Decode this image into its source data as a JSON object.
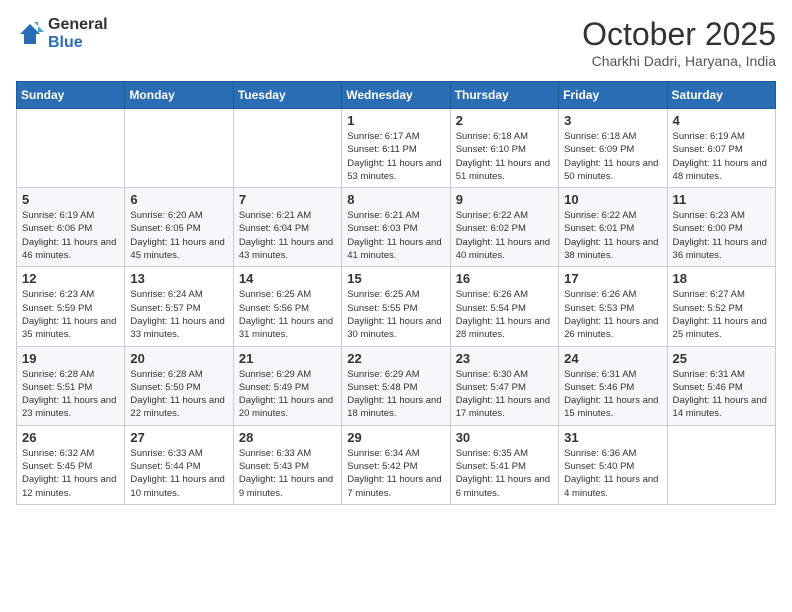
{
  "logo": {
    "general": "General",
    "blue": "Blue"
  },
  "header": {
    "month": "October 2025",
    "location": "Charkhi Dadri, Haryana, India"
  },
  "weekdays": [
    "Sunday",
    "Monday",
    "Tuesday",
    "Wednesday",
    "Thursday",
    "Friday",
    "Saturday"
  ],
  "weeks": [
    [
      {
        "day": "",
        "info": ""
      },
      {
        "day": "",
        "info": ""
      },
      {
        "day": "",
        "info": ""
      },
      {
        "day": "1",
        "info": "Sunrise: 6:17 AM\nSunset: 6:11 PM\nDaylight: 11 hours and 53 minutes."
      },
      {
        "day": "2",
        "info": "Sunrise: 6:18 AM\nSunset: 6:10 PM\nDaylight: 11 hours and 51 minutes."
      },
      {
        "day": "3",
        "info": "Sunrise: 6:18 AM\nSunset: 6:09 PM\nDaylight: 11 hours and 50 minutes."
      },
      {
        "day": "4",
        "info": "Sunrise: 6:19 AM\nSunset: 6:07 PM\nDaylight: 11 hours and 48 minutes."
      }
    ],
    [
      {
        "day": "5",
        "info": "Sunrise: 6:19 AM\nSunset: 6:06 PM\nDaylight: 11 hours and 46 minutes."
      },
      {
        "day": "6",
        "info": "Sunrise: 6:20 AM\nSunset: 6:05 PM\nDaylight: 11 hours and 45 minutes."
      },
      {
        "day": "7",
        "info": "Sunrise: 6:21 AM\nSunset: 6:04 PM\nDaylight: 11 hours and 43 minutes."
      },
      {
        "day": "8",
        "info": "Sunrise: 6:21 AM\nSunset: 6:03 PM\nDaylight: 11 hours and 41 minutes."
      },
      {
        "day": "9",
        "info": "Sunrise: 6:22 AM\nSunset: 6:02 PM\nDaylight: 11 hours and 40 minutes."
      },
      {
        "day": "10",
        "info": "Sunrise: 6:22 AM\nSunset: 6:01 PM\nDaylight: 11 hours and 38 minutes."
      },
      {
        "day": "11",
        "info": "Sunrise: 6:23 AM\nSunset: 6:00 PM\nDaylight: 11 hours and 36 minutes."
      }
    ],
    [
      {
        "day": "12",
        "info": "Sunrise: 6:23 AM\nSunset: 5:59 PM\nDaylight: 11 hours and 35 minutes."
      },
      {
        "day": "13",
        "info": "Sunrise: 6:24 AM\nSunset: 5:57 PM\nDaylight: 11 hours and 33 minutes."
      },
      {
        "day": "14",
        "info": "Sunrise: 6:25 AM\nSunset: 5:56 PM\nDaylight: 11 hours and 31 minutes."
      },
      {
        "day": "15",
        "info": "Sunrise: 6:25 AM\nSunset: 5:55 PM\nDaylight: 11 hours and 30 minutes."
      },
      {
        "day": "16",
        "info": "Sunrise: 6:26 AM\nSunset: 5:54 PM\nDaylight: 11 hours and 28 minutes."
      },
      {
        "day": "17",
        "info": "Sunrise: 6:26 AM\nSunset: 5:53 PM\nDaylight: 11 hours and 26 minutes."
      },
      {
        "day": "18",
        "info": "Sunrise: 6:27 AM\nSunset: 5:52 PM\nDaylight: 11 hours and 25 minutes."
      }
    ],
    [
      {
        "day": "19",
        "info": "Sunrise: 6:28 AM\nSunset: 5:51 PM\nDaylight: 11 hours and 23 minutes."
      },
      {
        "day": "20",
        "info": "Sunrise: 6:28 AM\nSunset: 5:50 PM\nDaylight: 11 hours and 22 minutes."
      },
      {
        "day": "21",
        "info": "Sunrise: 6:29 AM\nSunset: 5:49 PM\nDaylight: 11 hours and 20 minutes."
      },
      {
        "day": "22",
        "info": "Sunrise: 6:29 AM\nSunset: 5:48 PM\nDaylight: 11 hours and 18 minutes."
      },
      {
        "day": "23",
        "info": "Sunrise: 6:30 AM\nSunset: 5:47 PM\nDaylight: 11 hours and 17 minutes."
      },
      {
        "day": "24",
        "info": "Sunrise: 6:31 AM\nSunset: 5:46 PM\nDaylight: 11 hours and 15 minutes."
      },
      {
        "day": "25",
        "info": "Sunrise: 6:31 AM\nSunset: 5:46 PM\nDaylight: 11 hours and 14 minutes."
      }
    ],
    [
      {
        "day": "26",
        "info": "Sunrise: 6:32 AM\nSunset: 5:45 PM\nDaylight: 11 hours and 12 minutes."
      },
      {
        "day": "27",
        "info": "Sunrise: 6:33 AM\nSunset: 5:44 PM\nDaylight: 11 hours and 10 minutes."
      },
      {
        "day": "28",
        "info": "Sunrise: 6:33 AM\nSunset: 5:43 PM\nDaylight: 11 hours and 9 minutes."
      },
      {
        "day": "29",
        "info": "Sunrise: 6:34 AM\nSunset: 5:42 PM\nDaylight: 11 hours and 7 minutes."
      },
      {
        "day": "30",
        "info": "Sunrise: 6:35 AM\nSunset: 5:41 PM\nDaylight: 11 hours and 6 minutes."
      },
      {
        "day": "31",
        "info": "Sunrise: 6:36 AM\nSunset: 5:40 PM\nDaylight: 11 hours and 4 minutes."
      },
      {
        "day": "",
        "info": ""
      }
    ]
  ]
}
